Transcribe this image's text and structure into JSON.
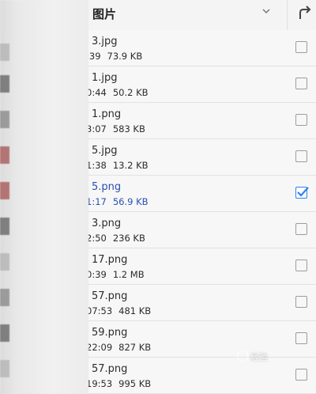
{
  "header": {
    "title": "图片"
  },
  "files": [
    {
      "name": "3.jpg",
      "time": ":39",
      "size": "73.9 KB",
      "checked": false
    },
    {
      "name": "1.jpg",
      "time": "0:44",
      "size": "50.2 KB",
      "checked": false
    },
    {
      "name": "1.png",
      "time": "3:07",
      "size": "583 KB",
      "checked": false
    },
    {
      "name": "5.jpg",
      "time": "1:38",
      "size": "13.2 KB",
      "checked": false
    },
    {
      "name": "5.png",
      "time": "1:17",
      "size": "56.9 KB",
      "checked": true
    },
    {
      "name": "3.png",
      "time": "2:50",
      "size": "236 KB",
      "checked": false
    },
    {
      "name": "17.png",
      "time": "0:39",
      "size": "1.2 MB",
      "checked": false
    },
    {
      "name": "57.png",
      "time": "07:53",
      "size": "481 KB",
      "checked": false
    },
    {
      "name": "59.png",
      "time": "22:09",
      "size": "827 KB",
      "checked": false
    },
    {
      "name": "57.png",
      "time": "19:53",
      "size": "995 KB",
      "checked": false
    }
  ],
  "watermark": "经验"
}
